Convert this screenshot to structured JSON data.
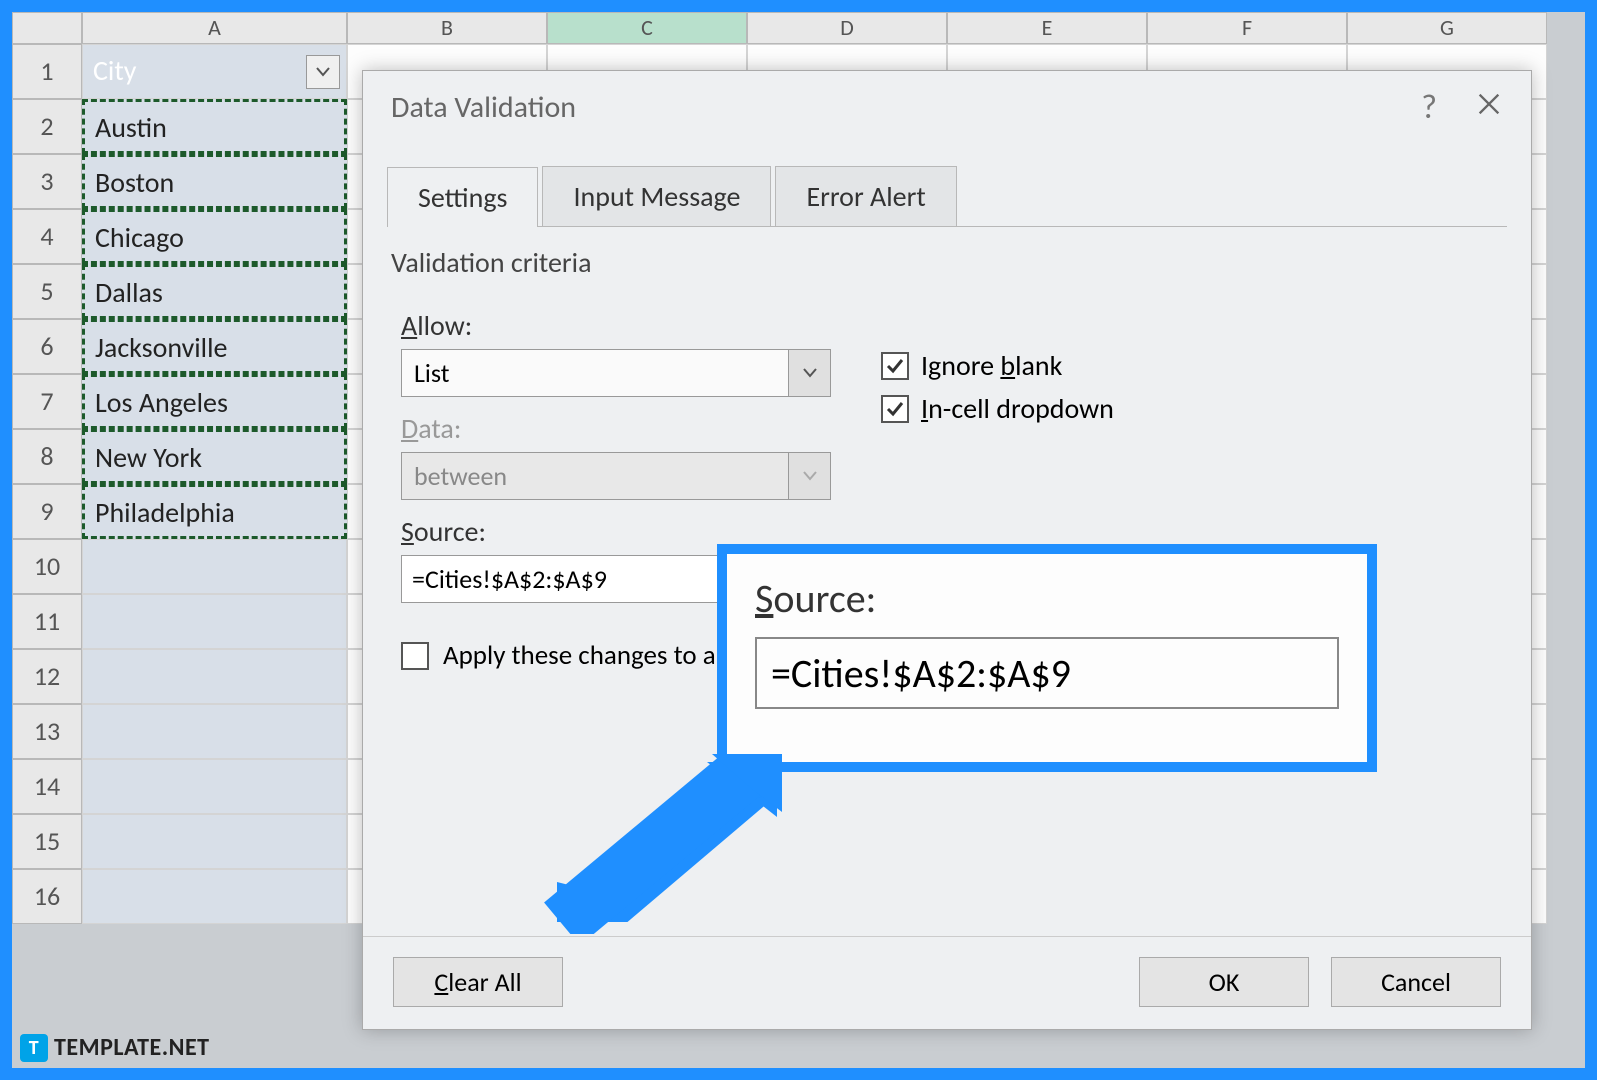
{
  "columns": [
    "A",
    "B",
    "C",
    "D",
    "E",
    "F",
    "G"
  ],
  "rows": [
    "1",
    "2",
    "3",
    "4",
    "5",
    "6",
    "7",
    "8",
    "9",
    "10",
    "11",
    "12",
    "13",
    "14",
    "15",
    "16"
  ],
  "cells": {
    "A1": "City",
    "A2": "Austin",
    "A3": "Boston",
    "A4": "Chicago",
    "A5": "Dallas",
    "A6": "Jacksonville",
    "A7": "Los Angeles",
    "A8": "New York",
    "A9": "Philadelphia"
  },
  "dialog": {
    "title": "Data Validation",
    "tabs": {
      "settings": "Settings",
      "input_message": "Input Message",
      "error_alert": "Error Alert"
    },
    "criteria_label": "Validation criteria",
    "allow_label": "Allow:",
    "allow_value": "List",
    "data_label": "Data:",
    "data_value": "between",
    "ignore_blank": "Ignore blank",
    "incell_dropdown": "In-cell dropdown",
    "source_label": "Source:",
    "source_value": "=Cities!$A$2:$A$9",
    "apply_label": "Apply these changes to all other cells with the same settings",
    "clear_all": "Clear All",
    "ok": "OK",
    "cancel": "Cancel",
    "help": "?"
  },
  "callout": {
    "source_label": "Source:",
    "source_value": "=Cities!$A$2:$A$9"
  },
  "watermark": "TEMPLATE.NET"
}
